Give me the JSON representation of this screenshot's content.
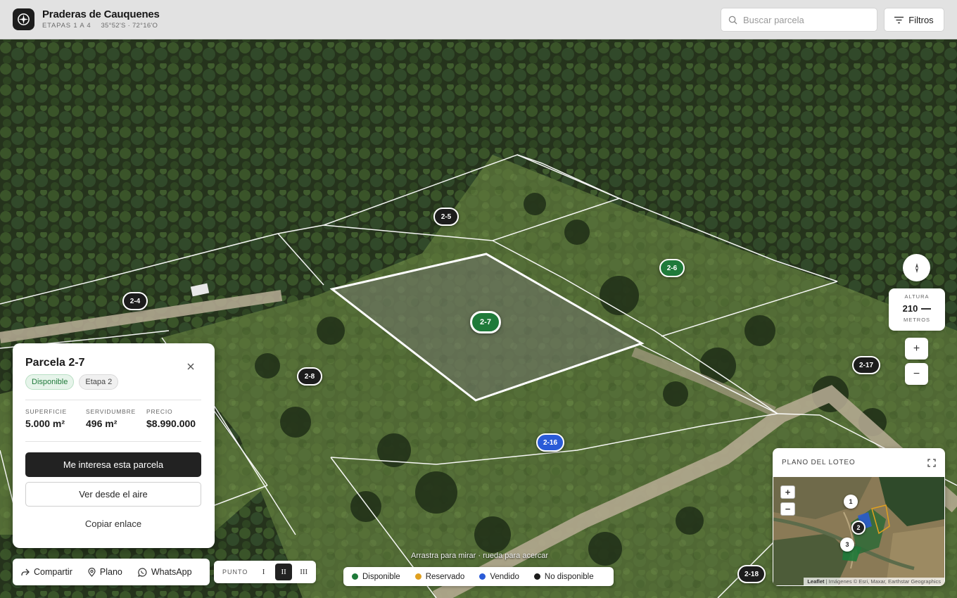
{
  "header": {
    "title": "Praderas de Cauquenes",
    "stages": "ETAPAS 1 A 4",
    "coords": "35°52'S · 72°16'O",
    "search_placeholder": "Buscar parcela",
    "filters_label": "Filtros"
  },
  "map": {
    "drag_hint": "Arrastra para mirar · rueda para acercar",
    "markers": [
      {
        "id": "2-5",
        "status": "no-disponible"
      },
      {
        "id": "2-6",
        "status": "disponible"
      },
      {
        "id": "2-4",
        "status": "no-disponible"
      },
      {
        "id": "2-7",
        "status": "seleccionada"
      },
      {
        "id": "2-8",
        "status": "no-disponible"
      },
      {
        "id": "2-17",
        "status": "no-disponible"
      },
      {
        "id": "2-16",
        "status": "vendido"
      },
      {
        "id": "2-18",
        "status": "no-disponible"
      }
    ]
  },
  "controls": {
    "altitude_label": "ALTURA",
    "altitude_value": "210",
    "altitude_unit": "METROS",
    "zoom_in": "+",
    "zoom_out": "−"
  },
  "minimap": {
    "title": "PLANO DEL LOTEO",
    "zoom_in": "+",
    "zoom_out": "−",
    "markers": [
      "1",
      "2",
      "3"
    ],
    "attribution_leaflet": "Leaflet",
    "attribution_text": " | Imágenes © Esri, Maxar, Earthstar Geographics"
  },
  "card": {
    "title": "Parcela 2-7",
    "status_badge": "Disponible",
    "stage_badge": "Etapa 2",
    "stats": [
      {
        "label": "SUPERFICIE",
        "value": "5.000 m²"
      },
      {
        "label": "SERVIDUMBRE",
        "value": "496 m²"
      },
      {
        "label": "PRECIO",
        "value": "$8.990.000"
      }
    ],
    "primary_button": "Me interesa esta parcela",
    "secondary_button": "Ver desde el aire",
    "link_button": "Copiar enlace"
  },
  "share_bar": {
    "share": "Compartir",
    "plan": "Plano",
    "whatsapp": "WhatsApp"
  },
  "point_bar": {
    "label": "PUNTO",
    "options": [
      "I",
      "II",
      "III"
    ],
    "active": "II"
  },
  "legend": [
    {
      "label": "Disponible",
      "color": "#1f7a3a"
    },
    {
      "label": "Reservado",
      "color": "#e0a020"
    },
    {
      "label": "Vendido",
      "color": "#2a5bd7"
    },
    {
      "label": "No disponible",
      "color": "#1c1c1c"
    }
  ]
}
